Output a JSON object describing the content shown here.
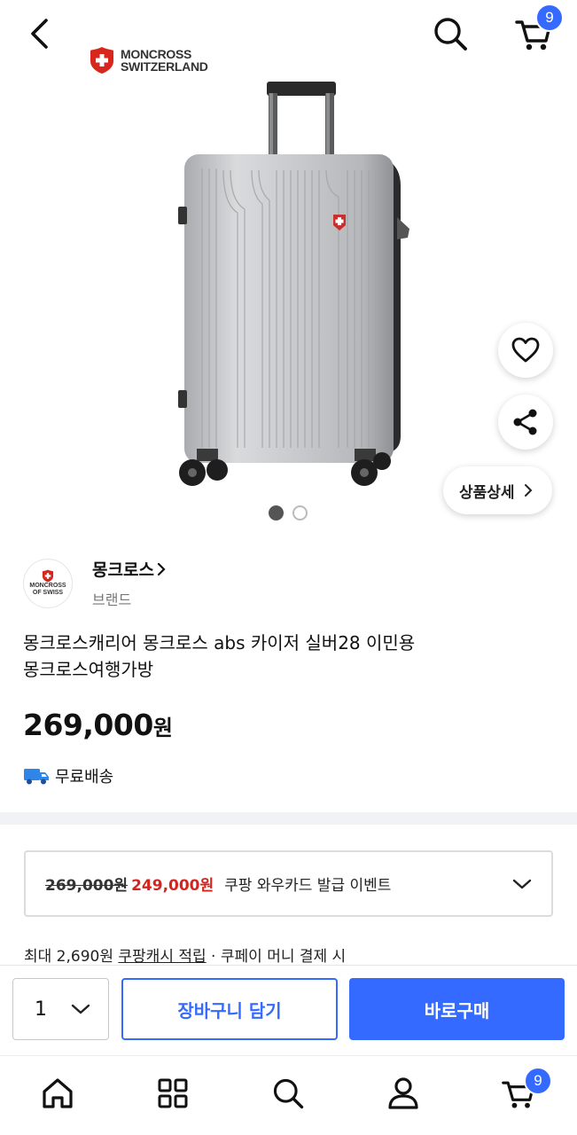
{
  "header": {
    "cart_count": "9",
    "icons": [
      "back-icon",
      "search-icon",
      "cart-icon"
    ]
  },
  "gallery": {
    "brand_logo_line1": "MONCROSS",
    "brand_logo_line2": "SWITZERLAND",
    "detail_chip_label": "상품상세",
    "image_count": 2,
    "active_index": 0
  },
  "brand": {
    "name": "몽크로스",
    "sub_label": "브랜드",
    "avatar_line1": "MONCROSS",
    "avatar_line2": "OF SWISS"
  },
  "product": {
    "title_line1": "몽크로스캐리어 몽크로스 abs 카이저 실버28 이민용",
    "title_line2": "몽크로스여행가방",
    "price": "269,000",
    "price_unit": "원",
    "shipping": "무료배송"
  },
  "promo": {
    "old_price": "269,000원",
    "new_price": "249,000원",
    "description": "쿠팡 와우카드 발급 이벤트"
  },
  "cash_back": {
    "prefix": "최대 2,690원 ",
    "link": "쿠팡캐시 적립",
    "suffix": " · 쿠페이 머니 결제 시"
  },
  "buy_bar": {
    "quantity": "1",
    "add_to_cart": "장바구니 담기",
    "buy_now": "바로구매"
  },
  "bottom_nav": {
    "cart_count": "9",
    "items": [
      "home-icon",
      "category-icon",
      "search-icon",
      "account-icon",
      "cart-icon"
    ]
  },
  "colors": {
    "accent": "#346aff",
    "sale_red": "#d6231c"
  }
}
